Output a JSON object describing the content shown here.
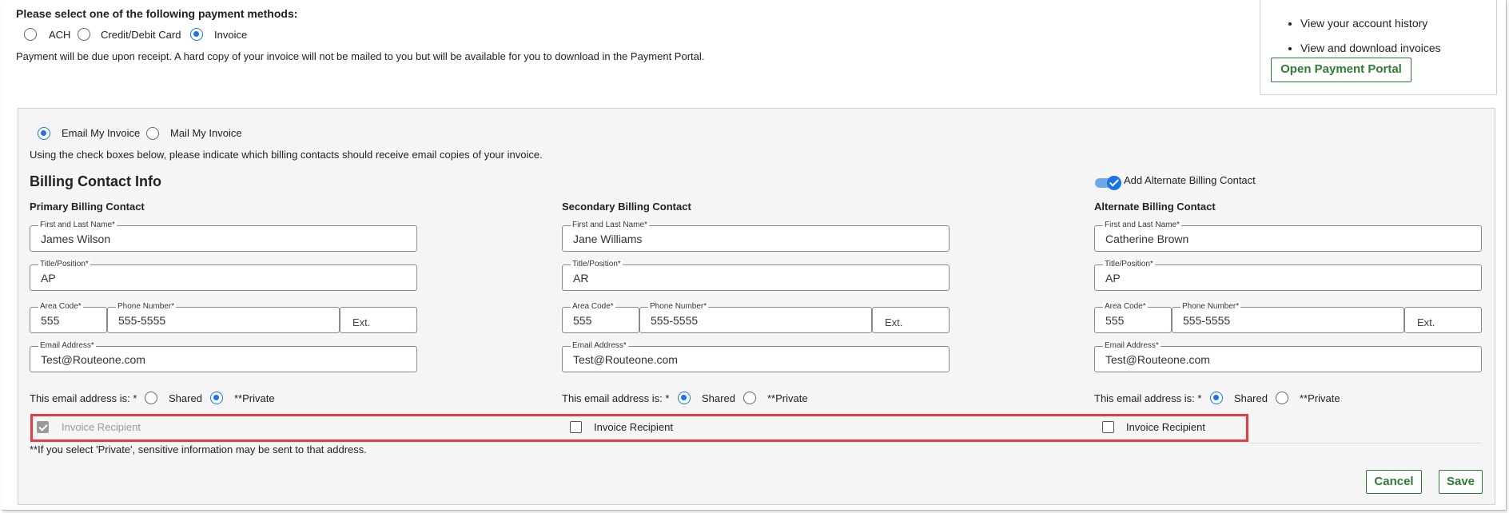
{
  "payment": {
    "heading": "Please select one of the following payment methods:",
    "methods": [
      {
        "label": "ACH",
        "selected": false
      },
      {
        "label": "Credit/Debit Card",
        "selected": false
      },
      {
        "label": "Invoice",
        "selected": true
      }
    ],
    "note": "Payment will be due upon receipt. A hard copy of your invoice will not be mailed to you but will be available for you to download in the Payment Portal."
  },
  "portal": {
    "items": [
      "View your account history",
      "View and download invoices"
    ],
    "button_label": "Open Payment Portal"
  },
  "delivery": {
    "options": [
      {
        "label": "Email My Invoice",
        "selected": true
      },
      {
        "label": "Mail My Invoice",
        "selected": false
      }
    ],
    "instruction": "Using the check boxes below, please indicate which billing contacts should receive email copies of your invoice."
  },
  "billing": {
    "title": "Billing Contact Info",
    "toggle_label": "Add Alternate Billing Contact",
    "toggle_on": true,
    "field_labels": {
      "name": "First and Last Name*",
      "title": "Title/Position*",
      "area_code": "Area Code*",
      "phone": "Phone Number*",
      "ext": "Ext.",
      "email": "Email Address*"
    },
    "email_is_label": "This email address is: *",
    "shared_label": "Shared",
    "private_label": "**Private",
    "recipient_label": "Invoice Recipient",
    "contacts": [
      {
        "heading": "Primary Billing Contact",
        "name": "James Wilson",
        "title": "AP",
        "area_code": "555",
        "phone": "555-5555",
        "email": "Test@Routeone.com",
        "sharing": "private",
        "recipient": true,
        "recipient_disabled": true
      },
      {
        "heading": "Secondary Billing Contact",
        "name": "Jane Williams",
        "title": "AR",
        "area_code": "555",
        "phone": "555-5555",
        "email": "Test@Routeone.com",
        "sharing": "shared",
        "recipient": false,
        "recipient_disabled": false
      },
      {
        "heading": "Alternate Billing Contact",
        "name": "Catherine Brown",
        "title": "AP",
        "area_code": "555",
        "phone": "555-5555",
        "email": "Test@Routeone.com",
        "sharing": "shared",
        "recipient": false,
        "recipient_disabled": false
      }
    ],
    "footnote": "**If you select 'Private', sensitive information may be sent to that address."
  },
  "actions": {
    "cancel_label": "Cancel",
    "save_label": "Save"
  },
  "colors": {
    "accent": "#1a73e8",
    "action_green": "#2e7d32",
    "highlight_red": "#e53945"
  }
}
